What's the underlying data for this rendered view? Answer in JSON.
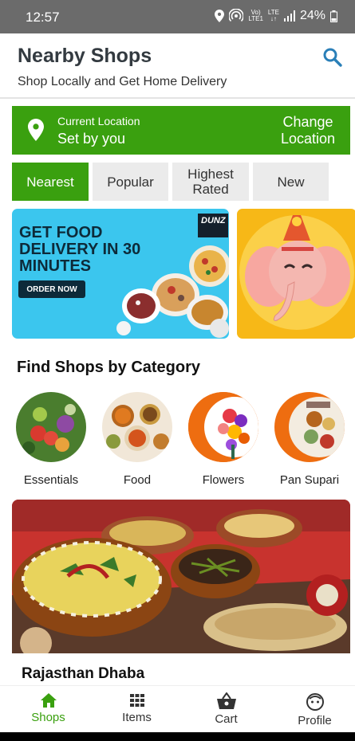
{
  "status_bar": {
    "time": "12:57",
    "network_top": "Vo)",
    "network_bottom": "LTE1",
    "lte_top": "LTE",
    "lte_bottom": "↓↑",
    "battery": "24%"
  },
  "header": {
    "title": "Nearby Shops",
    "subtitle": "Shop Locally and Get Home Delivery",
    "search_icon": "search-icon"
  },
  "location": {
    "caption": "Current Location",
    "value": "Set by you",
    "change_label": "Change Location",
    "icon": "map-pin-icon"
  },
  "tabs": [
    {
      "label": "Nearest",
      "active": true
    },
    {
      "label": "Popular",
      "active": false
    },
    {
      "label": "Highest Rated",
      "active": false
    },
    {
      "label": "New",
      "active": false
    }
  ],
  "banners": {
    "food": {
      "headline": "GET FOOD DELIVERY IN 30 MINUTES",
      "button": "ORDER NOW",
      "brand": "DUNZ"
    }
  },
  "categories": {
    "title": "Find Shops by Category",
    "items": [
      {
        "label": "Essentials"
      },
      {
        "label": "Food"
      },
      {
        "label": "Flowers"
      },
      {
        "label": "Pan Supari"
      }
    ]
  },
  "shop": {
    "name": "Rajasthan Dhaba"
  },
  "bottom_nav": [
    {
      "label": "Shops",
      "icon": "home-icon",
      "active": true
    },
    {
      "label": "Items",
      "icon": "grid-icon",
      "active": false
    },
    {
      "label": "Cart",
      "icon": "basket-icon",
      "active": false
    },
    {
      "label": "Profile",
      "icon": "face-icon",
      "active": false
    }
  ],
  "colors": {
    "accent": "#3aa00f",
    "tab_inactive": "#ebebeb",
    "search": "#2a7fb8"
  }
}
